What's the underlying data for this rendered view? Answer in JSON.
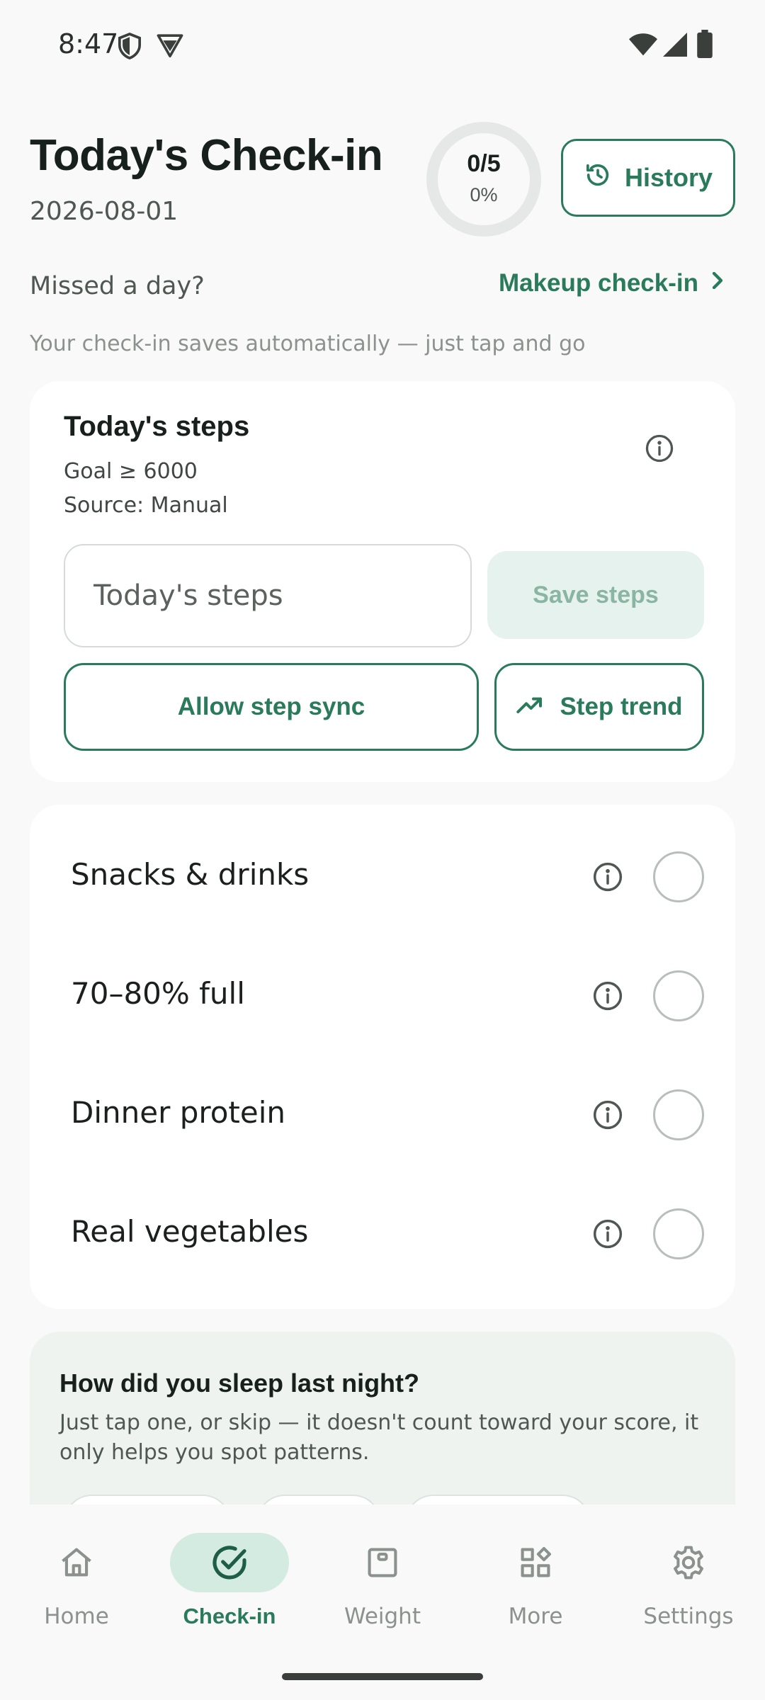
{
  "status_bar": {
    "time": "8:47",
    "left_icons": [
      "shield-icon",
      "vpn-shield-icon"
    ],
    "right_icons": [
      "wifi-icon",
      "signal-icon",
      "battery-icon"
    ]
  },
  "header": {
    "title": "Today's Check-in",
    "date": "2026-08-01",
    "progress_count": "0/5",
    "progress_percent": "0%",
    "progress_fraction": 0,
    "history_label": "History"
  },
  "makeup": {
    "question": "Missed a day?",
    "link_label": "Makeup check-in"
  },
  "autosave_hint": "Your check-in saves automatically — just tap and go",
  "steps_card": {
    "title": "Today's steps",
    "goal": "Goal ≥ 6000",
    "source": "Source: Manual",
    "input_placeholder": "Today's steps",
    "save_label": "Save steps",
    "sync_label": "Allow step sync",
    "trend_label": "Step trend"
  },
  "habits": [
    {
      "label": "Snacks & drinks",
      "checked": false
    },
    {
      "label": "70–80% full",
      "checked": false
    },
    {
      "label": "Dinner protein",
      "checked": false
    },
    {
      "label": "Real vegetables",
      "checked": false
    }
  ],
  "sleep_card": {
    "title": "How did you sleep last night?",
    "description": "Just tap one, or skip — it doesn't count toward your score, it only helps you spot patterns."
  },
  "bottom_nav": {
    "items": [
      {
        "label": "Home",
        "icon": "home-icon",
        "active": false
      },
      {
        "label": "Check-in",
        "icon": "check-circle-icon",
        "active": true
      },
      {
        "label": "Weight",
        "icon": "scale-icon",
        "active": false
      },
      {
        "label": "More",
        "icon": "grid-icon",
        "active": false
      },
      {
        "label": "Settings",
        "icon": "gear-icon",
        "active": false
      }
    ]
  },
  "colors": {
    "accent": "#2a7a5c",
    "accent_soft": "#d4ebe1",
    "background": "#f8f9f8",
    "card": "#ffffff"
  }
}
